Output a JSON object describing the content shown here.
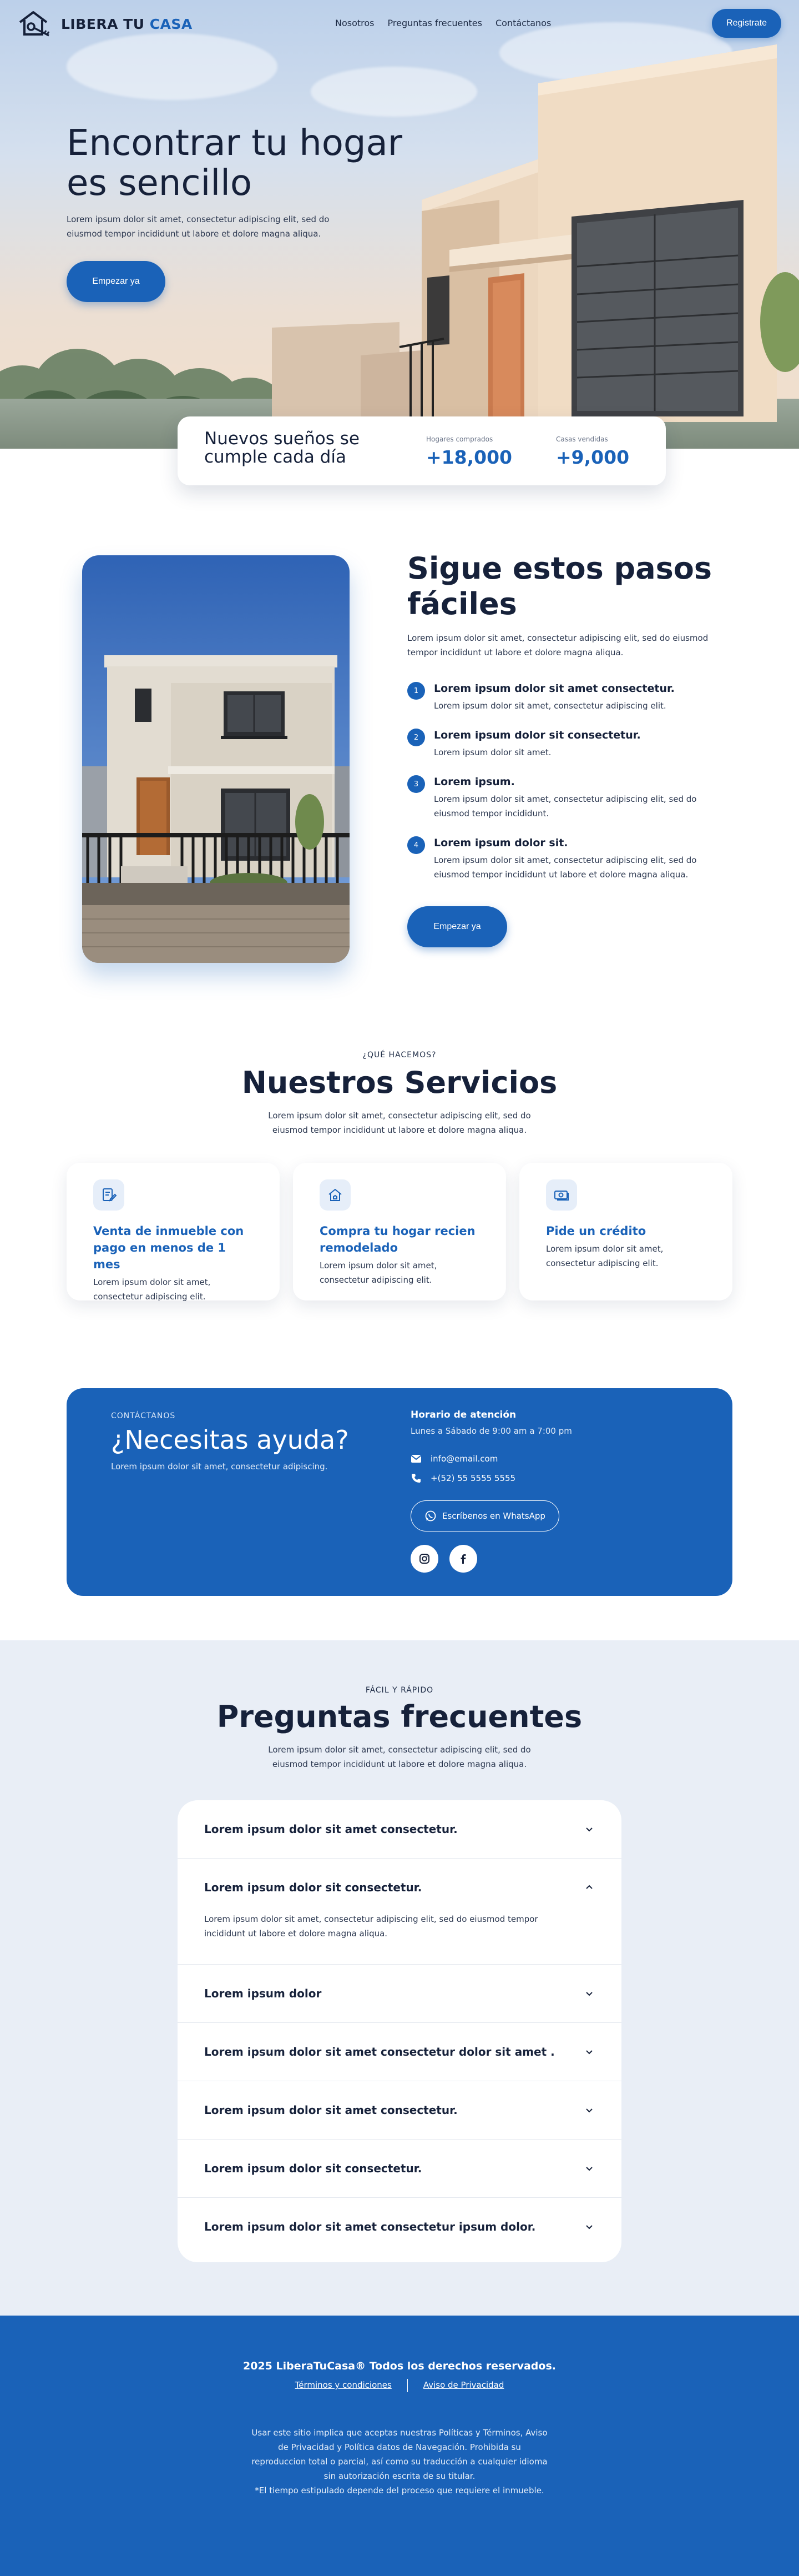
{
  "brand": {
    "name_part1": "LIBERA TU ",
    "name_part2": "CASA"
  },
  "nav": {
    "links": [
      "Nosotros",
      "Preguntas frecuentes",
      "Contáctanos"
    ],
    "register_label": "Registrate"
  },
  "hero": {
    "title": "Encontrar tu hogar es sencillo",
    "subtitle": "Lorem ipsum dolor sit amet, consectetur adipiscing elit, sed do eiusmod tempor incididunt ut labore et dolore magna aliqua.",
    "cta": "Empezar ya"
  },
  "stats": {
    "title": "Nuevos sueños se cumple cada día",
    "items": [
      {
        "label": "Hogares comprados",
        "value": "+18,000"
      },
      {
        "label": "Casas vendidas",
        "value": "+9,000"
      }
    ]
  },
  "steps": {
    "title": "Sigue estos pasos fáciles",
    "subtitle": "Lorem ipsum dolor sit amet, consectetur adipiscing elit, sed do eiusmod tempor incididunt ut labore et dolore magna aliqua.",
    "items": [
      {
        "num": "1",
        "title": "Lorem ipsum dolor sit amet consectetur.",
        "desc": "Lorem ipsum dolor sit amet, consectetur adipiscing elit."
      },
      {
        "num": "2",
        "title": "Lorem ipsum dolor sit consectetur.",
        "desc": "Lorem ipsum dolor sit amet."
      },
      {
        "num": "3",
        "title": "Lorem ipsum.",
        "desc": "Lorem ipsum dolor sit amet, consectetur adipiscing elit, sed do eiusmod tempor incididunt."
      },
      {
        "num": "4",
        "title": "Lorem ipsum dolor sit.",
        "desc": "Lorem ipsum dolor sit amet, consectetur adipiscing elit, sed do eiusmod tempor incididunt ut labore et dolore magna aliqua."
      }
    ],
    "cta": "Empezar ya"
  },
  "services": {
    "eyebrow": "¿QUÉ HACEMOS?",
    "title": "Nuestros Servicios",
    "subtitle": "Lorem ipsum dolor sit amet, consectetur adipiscing elit, sed do eiusmod tempor incididunt ut labore et dolore magna aliqua.",
    "items": [
      {
        "icon": "document-edit-icon",
        "title": "Venta de inmueble con pago en menos de 1 mes",
        "desc": "Lorem ipsum dolor sit amet, consectetur adipiscing elit."
      },
      {
        "icon": "house-icon",
        "title": "Compra tu hogar recien remodelado",
        "desc": "Lorem ipsum dolor sit amet, consectetur adipiscing elit."
      },
      {
        "icon": "money-icon",
        "title": "Pide un crédito",
        "desc": "Lorem ipsum dolor sit amet, consectetur adipiscing elit."
      }
    ]
  },
  "contact": {
    "eyebrow": "CONTÁCTANOS",
    "title": "¿Necesitas ayuda?",
    "text": "Lorem ipsum dolor sit amet, consectetur adipiscing.",
    "hours_title": "Horario de atención",
    "hours": "Lunes a Sábado de 9:00 am a 7:00 pm",
    "email": "info@email.com",
    "phone": "+(52) 55 5555 5555",
    "whatsapp_label": "Escríbenos en WhatsApp"
  },
  "faq": {
    "eyebrow": "FÁCIL Y RÁPIDO",
    "title": "Preguntas frecuentes",
    "subtitle": "Lorem ipsum dolor sit amet, consectetur adipiscing elit, sed do eiusmod tempor incididunt ut labore et dolore magna aliqua.",
    "items": [
      {
        "q": "Lorem ipsum dolor sit amet consectetur.",
        "open": false
      },
      {
        "q": "Lorem ipsum dolor sit consectetur.",
        "open": true,
        "a": "Lorem ipsum dolor sit amet, consectetur adipiscing elit, sed do eiusmod tempor incididunt ut labore et dolore magna aliqua."
      },
      {
        "q": "Lorem ipsum dolor",
        "open": false
      },
      {
        "q": "Lorem ipsum dolor sit amet consectetur dolor sit amet .",
        "open": false
      },
      {
        "q": "Lorem ipsum dolor sit amet consectetur.",
        "open": false
      },
      {
        "q": "Lorem ipsum dolor sit consectetur.",
        "open": false
      },
      {
        "q": "Lorem ipsum dolor sit amet consectetur ipsum dolor.",
        "open": false
      }
    ]
  },
  "footer": {
    "copyright": "2025 LiberaTuCasa® Todos los derechos reservados.",
    "terms": "Términos y condiciones",
    "privacy": "Aviso de Privacidad",
    "legal": "Usar este sitio implica que aceptas nuestras Políticas y Términos, Aviso de Privacidad y Política datos de Navegación. Prohibida su reproduccion total o parcial, así como su traducción a cualquier idioma sin autorización escrita de su titular.",
    "note": "*El tiempo estipulado depende del proceso que requiere el inmueble."
  },
  "colors": {
    "primary": "#1a62b8",
    "dark_text": "#16213a",
    "faq_bg": "#e9eef6"
  }
}
